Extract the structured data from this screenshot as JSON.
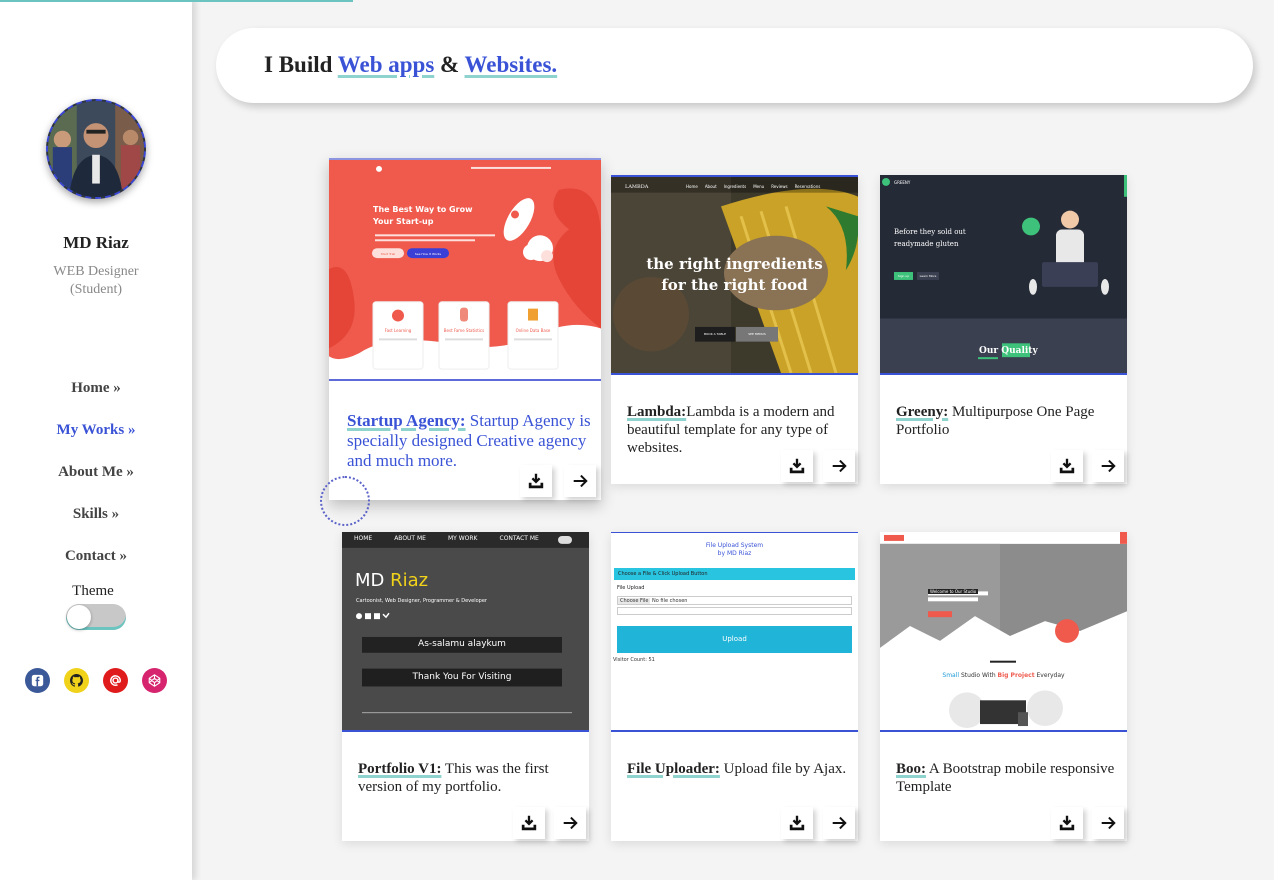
{
  "profile": {
    "name": "MD Riaz",
    "role": "WEB Designer (Student)"
  },
  "nav": [
    {
      "label": "Home »"
    },
    {
      "label": "My Works »"
    },
    {
      "label": "About Me »"
    },
    {
      "label": "Skills »"
    },
    {
      "label": "Contact »"
    }
  ],
  "theme_label": "Theme",
  "socials": [
    {
      "icon": "facebook-icon",
      "color": "#3b5998"
    },
    {
      "icon": "github-icon",
      "color": "#f0d21a"
    },
    {
      "icon": "email-icon",
      "color": "#e01b1b"
    },
    {
      "icon": "codepen-icon",
      "color": "#d6246e"
    }
  ],
  "header": {
    "prefix": "I Build ",
    "link1": "Web apps",
    "amp": " & ",
    "link2": "Websites."
  },
  "projects": [
    {
      "title": "Startup Agency:",
      "text": " Startup Agency is specially designed Creative agency and much more.",
      "shot": {
        "heading": "The Best Way to Grow Your Start-up",
        "btn1": "Start Trial",
        "btn2": "See How It Works",
        "f1": "Fast Learning",
        "f2": "Best Fame Statistics",
        "f3": "Online Data Base"
      }
    },
    {
      "title": "Lambda:",
      "text": "Lambda is a modern and beautiful template for any type of websites.",
      "shot": {
        "logo": "LAMBDA",
        "nav": [
          "Home",
          "About",
          "Ingredients",
          "Menu",
          "Reviews",
          "Reservations"
        ],
        "line1": "the right ingredients",
        "line2": "for the right food",
        "btn1": "BOOK A TABLE",
        "btn2": "SEE MENUS"
      }
    },
    {
      "title": "Greeny:",
      "text": " Multipurpose One Page Portfolio",
      "shot": {
        "logo": "GREENY",
        "line1": "Before they sold out",
        "line2": "readymade gluten",
        "btn1": "Sign up",
        "btn2": "Learn More",
        "section": "Our Quality"
      }
    },
    {
      "title": "Portfolio V1:",
      "text": " This was the first version of my portfolio.",
      "shot": {
        "nav": [
          "HOME",
          "ABOUT ME",
          "MY WORK",
          "CONTACT ME"
        ],
        "name1": "MD ",
        "name2": "Riaz",
        "tag": "Cartoonist, Web Designer, Programmer & Developer",
        "banner1": "As-salamu alaykum",
        "banner2": "Thank You For Visiting"
      }
    },
    {
      "title": "File Uploader:",
      "text": " Upload file by Ajax.",
      "shot": {
        "title1": "File Upload System",
        "title2": "by MD Riaz",
        "bar": "Choose a File & Click Upload Button",
        "label": "File Upload",
        "choose": "Choose File",
        "nofile": "No file chosen",
        "upload": "Upload",
        "count": "Visitor Count: 51"
      }
    },
    {
      "title": "Boo:",
      "text": " A Bootstrap mobile responsive Template",
      "shot": {
        "welcome": "Welcome to Our Studio",
        "tag_a": "Small",
        "tag_b": " Studio With ",
        "tag_c": "Big Project",
        "tag_d": " Everyday"
      }
    }
  ]
}
